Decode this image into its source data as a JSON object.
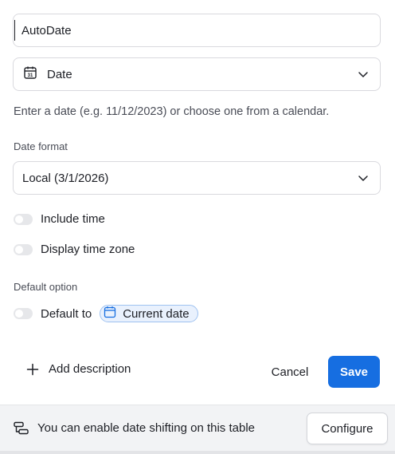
{
  "field": {
    "name_value": "AutoDate",
    "type_icon": "calendar-31-icon",
    "type_label": "Date",
    "help_text": "Enter a date (e.g. 11/12/2023) or choose one from a calendar."
  },
  "date_format": {
    "section_label": "Date format",
    "selected": "Local (3/1/2026)"
  },
  "toggles": {
    "include_time": {
      "label": "Include time",
      "on": false
    },
    "display_time_zone": {
      "label": "Display time zone",
      "on": false
    }
  },
  "default_option": {
    "section_label": "Default option",
    "toggle_label": "Default to",
    "toggle_on": false,
    "chip_label": "Current date",
    "chip_icon": "calendar-icon"
  },
  "actions": {
    "add_description": "Add description",
    "cancel": "Cancel",
    "save": "Save"
  },
  "footer": {
    "icon": "date-shift-icon",
    "message": "You can enable date shifting on this table",
    "configure": "Configure"
  },
  "colors": {
    "primary": "#166ee1",
    "chip_bg": "#e9f1fd",
    "chip_border": "#9fc2f0",
    "footer_bg": "#f2f3f5",
    "toggle_off": "#e6e7ea"
  }
}
